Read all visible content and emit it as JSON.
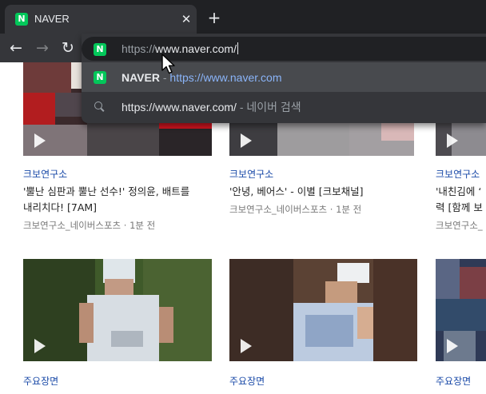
{
  "browser": {
    "tab": {
      "favicon": "N",
      "title": "NAVER",
      "close": "✕"
    },
    "new_tab": "+",
    "nav": {
      "back": "←",
      "forward": "→",
      "reload": "↻"
    },
    "omnibox": {
      "favicon": "N",
      "prefix": "https://",
      "domain": "www.naver.com/",
      "suggestions": [
        {
          "icon": "naver-favicon",
          "title": "NAVER",
          "separator": " - ",
          "url": "https://www.naver.com"
        },
        {
          "icon": "search-icon",
          "query": "https://www.naver.com/",
          "suffix": " - 네이버 검색"
        }
      ]
    }
  },
  "videos": [
    {
      "category": "크보연구소",
      "title_lines": [
        "'뿔난 심판과 뿔난 선수!' 정의윤, 배트를",
        "내리치다! [7AM]"
      ],
      "meta": "크보연구소_네이버스포츠 · 1분 전"
    },
    {
      "category": "크보연구소",
      "title_lines": [
        "'안녕, 베어스' - 이별 [크보채널]"
      ],
      "meta": "크보연구소_네이버스포츠 · 1분 전"
    },
    {
      "category": "크보연구소",
      "title_lines": [
        "'내친김에 ‘",
        "력 [함께 보"
      ],
      "meta": "크보연구소_"
    },
    {
      "category": "주요장면",
      "title_lines": [],
      "meta": ""
    },
    {
      "category": "주요장면",
      "title_lines": [],
      "meta": ""
    },
    {
      "category": "주요장면",
      "title_lines": [],
      "meta": ""
    }
  ]
}
